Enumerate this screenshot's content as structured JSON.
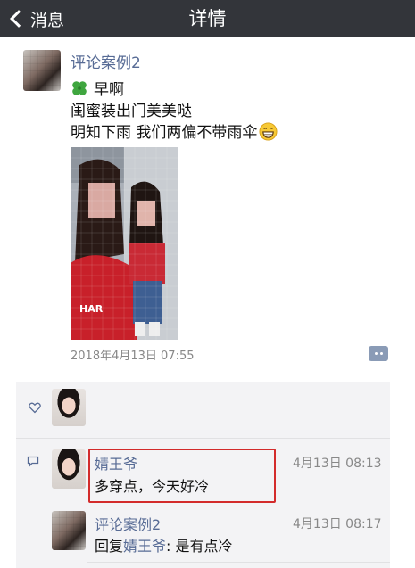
{
  "navbar": {
    "back_label": "消息",
    "title": "详情"
  },
  "post": {
    "author": "评论案例2",
    "lines": [
      "早啊",
      "闺蜜装出门美美哒",
      "明知下雨 我们两偏不带雨伞"
    ],
    "timestamp": "2018年4月13日 07:55"
  },
  "comments": [
    {
      "author": "婧王爷",
      "time": "4月13日 08:13",
      "text": "多穿点，今天好冷"
    },
    {
      "author": "评论案例2",
      "time": "4月13日 08:17",
      "reply_prefix": "回复",
      "reply_to": "婧王爷",
      "text": ": 是有点冷"
    }
  ],
  "colors": {
    "navbar": "#33353a",
    "name_link": "#576b95",
    "highlight": "#d32b2b",
    "feedback_bg": "#f3f3f5"
  }
}
